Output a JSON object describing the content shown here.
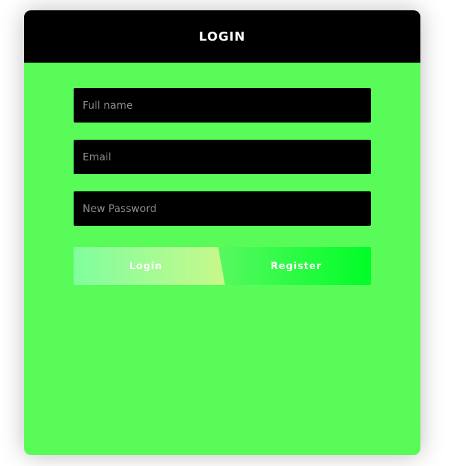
{
  "header": {
    "title": "LOGIN"
  },
  "form": {
    "full_name_placeholder": "Full name",
    "email_placeholder": "Email",
    "password_placeholder": "New Password",
    "full_name_value": "",
    "email_value": "",
    "password_value": ""
  },
  "actions": {
    "login_label": "Login",
    "register_label": "Register"
  },
  "colors": {
    "card_background": "#59fb58",
    "header_background": "#000000",
    "field_background": "#000000",
    "text_light": "#ffffff"
  }
}
